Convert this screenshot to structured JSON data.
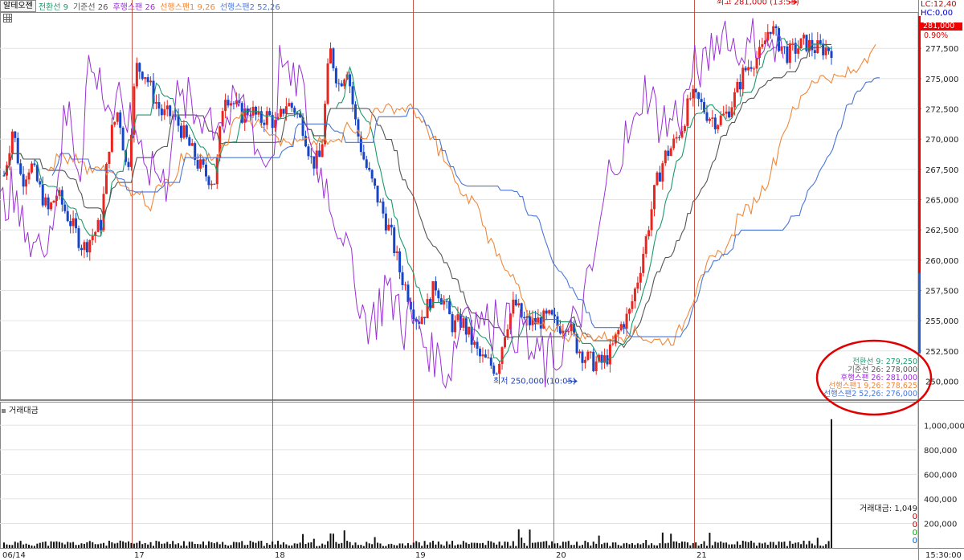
{
  "window": {
    "title": "알테오젠"
  },
  "legend": [
    {
      "label": "전환선 9",
      "color": "#1a9a6b"
    },
    {
      "label": "기준선 26",
      "color": "#555555"
    },
    {
      "label": "후행스팬 26",
      "color": "#9b30d6"
    },
    {
      "label": "선행스팬1 9,26",
      "color": "#f0883a"
    },
    {
      "label": "선행스팬2 52,26",
      "color": "#4a76d8"
    }
  ],
  "right_panel": {
    "lc": "LC:12,40",
    "hc": "HC:0,00",
    "current_price": "281,000",
    "change_pct": "0.90%"
  },
  "annotations": {
    "high": "최고 281,000 (13:55)",
    "low": "최저 250,000 (10:05)"
  },
  "ma_values": [
    {
      "label": "전환선 9",
      "value": "279,250",
      "color": "#1a9a6b"
    },
    {
      "label": "기준선 26",
      "value": "278,000",
      "color": "#555555"
    },
    {
      "label": "후행스팬 26",
      "value": "281,000",
      "color": "#9b30d6"
    },
    {
      "label": "선행스팬1 9,26",
      "value": "278,625",
      "color": "#f0883a"
    },
    {
      "label": "선행스팬2 52,26",
      "value": "276,000",
      "color": "#4a76d8"
    }
  ],
  "volume_panel": {
    "title": "거래대금",
    "value_label": "거래대금: 1,049",
    "zeros": [
      "0",
      "0",
      "0",
      "0"
    ]
  },
  "time_axis": {
    "right_label": "15:30:00"
  },
  "colors": {
    "up": "#e8261f",
    "down": "#1745c9",
    "volume": "#111111",
    "separator": "#c0392b",
    "circle": "#e00000"
  },
  "chart_data": [
    {
      "type": "line",
      "title": "알테오젠",
      "x_categories": [
        "06/14",
        "17",
        "18",
        "19",
        "20",
        "21"
      ],
      "ylim": [
        248500,
        281500
      ],
      "y_ticks": [
        252500,
        255000,
        257500,
        260000,
        262500,
        265000,
        267500,
        270000,
        272500,
        275000,
        277500
      ],
      "y_tick_labels": [
        "252,500",
        "255,000",
        "257,500",
        "260,000",
        "262,500",
        "265,000",
        "267,500",
        "270,000",
        "272,500",
        "275,000",
        "277,500"
      ],
      "series": [
        {
          "name": "price",
          "kind": "candlestick_approx",
          "x": [
            0,
            0.25,
            0.5,
            0.75,
            1,
            1.25,
            1.5,
            1.75,
            2,
            2.25,
            2.5,
            2.75,
            3,
            3.25,
            3.5,
            3.75,
            4,
            4.25,
            4.5,
            4.75,
            5,
            5.25,
            5.5,
            5.75,
            6,
            6.25,
            6.5,
            6.75,
            7,
            7.25,
            7.5,
            7.75,
            8,
            8.25,
            8.5,
            8.75,
            9,
            9.25,
            9.5,
            9.75,
            10,
            10.25,
            10.5,
            10.75,
            11,
            11.25,
            11.5,
            11.75,
            12,
            12.25,
            12.5,
            12.75,
            13,
            13.25,
            13.5,
            13.75,
            14,
            14.25,
            14.5,
            14.75,
            15,
            15.25,
            15.5,
            15.75,
            16,
            16.25,
            16.5,
            16.75,
            17,
            17.25,
            17.5,
            17.75,
            18,
            18.25,
            18.5,
            18.75,
            19,
            19.25,
            19.5,
            19.75,
            20,
            20.25,
            20.5,
            20.75,
            21,
            21.25,
            21.5,
            21.75,
            22,
            22.25,
            22.5,
            22.75,
            23,
            23.25,
            23.5
          ],
          "values": [
            267000,
            271000,
            266500,
            268000,
            266000,
            264000,
            265500,
            264000,
            262500,
            261000,
            262000,
            263000,
            270000,
            272500,
            267000,
            276000,
            275500,
            273500,
            272000,
            272000,
            271000,
            269500,
            268000,
            267000,
            266500,
            274000,
            273000,
            272000,
            272500,
            271500,
            272000,
            271000,
            273000,
            272500,
            271000,
            268000,
            268500,
            277500,
            274500,
            276000,
            271000,
            268000,
            266000,
            264000,
            262000,
            259000,
            257000,
            255000,
            256000,
            258000,
            256500,
            254500,
            255000,
            253500,
            252000,
            251500,
            251000,
            254500,
            256500,
            255000,
            254800,
            255000,
            255200,
            254500,
            255000,
            253000,
            252000,
            251500,
            251500,
            252500,
            254500,
            255500,
            258500,
            262000,
            266000,
            268500,
            269500,
            271000,
            273500,
            273000,
            272000,
            271500,
            272000,
            273500,
            275500,
            276500,
            277000,
            279500,
            278000,
            277000,
            277500,
            278000,
            277500,
            277500,
            277500
          ]
        },
        {
          "name": "전환선 9"
        },
        {
          "name": "기준선 26"
        },
        {
          "name": "후행스팬 26"
        },
        {
          "name": "선행스팬1 9,26"
        },
        {
          "name": "선행스팬2 52,26"
        }
      ],
      "extremes": {
        "high": 281000,
        "low": 250000
      }
    },
    {
      "type": "bar",
      "title": "거래대금",
      "ylim": [
        0,
        1100
      ],
      "y_ticks": [
        200,
        400,
        600,
        800,
        1000
      ],
      "y_tick_labels": [
        "200,000",
        "400,000",
        "600,000",
        "800,000",
        "1,000,000"
      ],
      "last_value": 1049
    }
  ]
}
